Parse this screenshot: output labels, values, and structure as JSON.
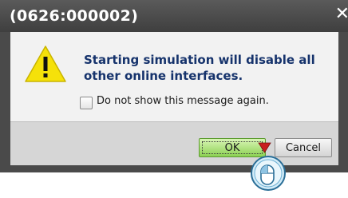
{
  "dialog": {
    "title": "(0626:000002)",
    "close_glyph": "✕",
    "message": "Starting simulation will disable all other online interfaces.",
    "checkbox_label": "Do not show this message again.",
    "ok_label": "OK",
    "cancel_label": "Cancel",
    "icon": "warning-icon",
    "colors": {
      "title_bg": "#4a4a4a",
      "message_text": "#16336c",
      "ok_bg": "#8cd153",
      "warning_yellow": "#f5e10a"
    }
  }
}
